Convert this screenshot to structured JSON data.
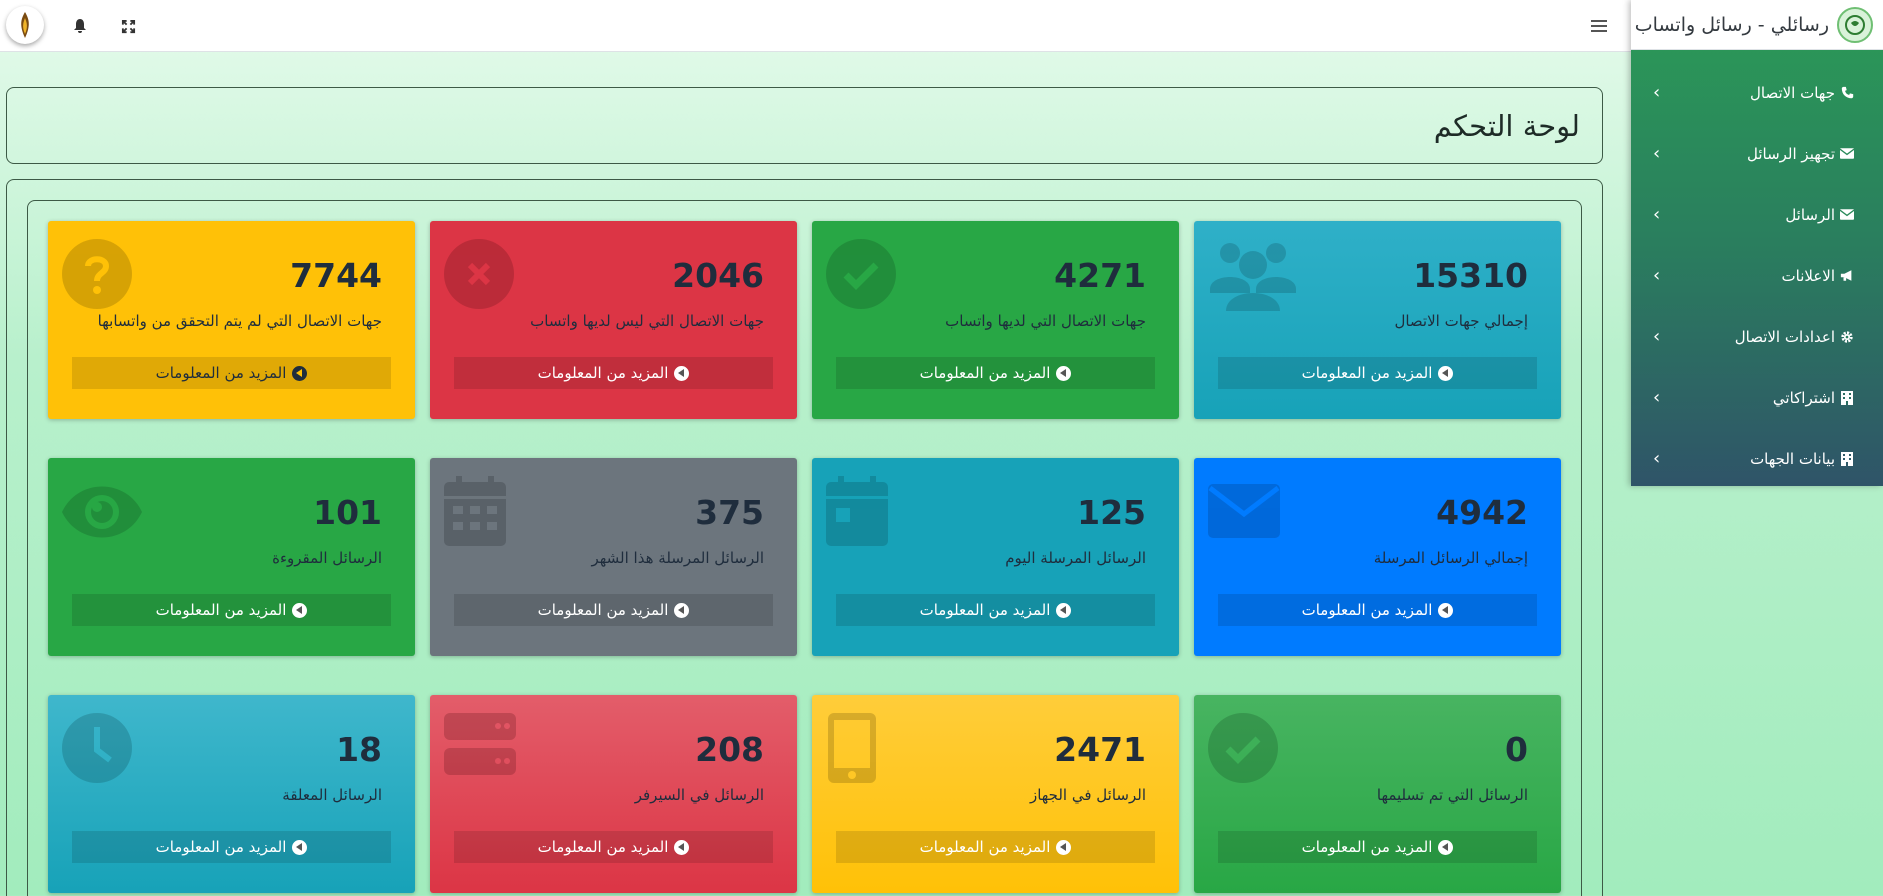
{
  "brand": {
    "title": "رسائلي - رسائل واتساب"
  },
  "page": {
    "title": "لوحة التحكم"
  },
  "sidebar": {
    "items": [
      {
        "label": "جهات الاتصال",
        "icon": "phone-icon"
      },
      {
        "label": "تجهيز الرسائل",
        "icon": "envelope-icon"
      },
      {
        "label": "الرسائل",
        "icon": "envelope-icon"
      },
      {
        "label": "الاعلانات",
        "icon": "bullhorn-icon"
      },
      {
        "label": "اعدادات الاتصال",
        "icon": "gear-icon"
      },
      {
        "label": "اشتراكاتي",
        "icon": "building-icon"
      },
      {
        "label": "بيانات الجهات",
        "icon": "building-icon"
      }
    ]
  },
  "cards": [
    {
      "value": "15310",
      "label": "إجمالي جهات الاتصال",
      "more": "المزيد من المعلومات",
      "color": "#17a2b8",
      "icon": "users-icon"
    },
    {
      "value": "4271",
      "label": "جهات الاتصال التي لديها واتساب",
      "more": "المزيد من المعلومات",
      "color": "#28a745",
      "icon": "check-circle-icon"
    },
    {
      "value": "2046",
      "label": "جهات الاتصال التي ليس لديها واتساب",
      "more": "المزيد من المعلومات",
      "color": "#dc3545",
      "icon": "times-circle-icon"
    },
    {
      "value": "7744",
      "label": "جهات الاتصال التي لم يتم التحقق من واتسابها",
      "more": "المزيد من المعلومات",
      "color": "#ffc107",
      "icon": "question-circle-icon"
    },
    {
      "value": "4942",
      "label": "إجمالي الرسائل المرسلة",
      "more": "المزيد من المعلومات",
      "color": "#007bff",
      "icon": "envelope-icon"
    },
    {
      "value": "125",
      "label": "الرسائل المرسلة اليوم",
      "more": "المزيد من المعلومات",
      "color": "#17a2b8",
      "icon": "calendar-day-icon"
    },
    {
      "value": "375",
      "label": "الرسائل المرسلة هذا الشهر",
      "more": "المزيد من المعلومات",
      "color": "#6c757d",
      "icon": "calendar-icon"
    },
    {
      "value": "101",
      "label": "الرسائل المقروءة",
      "more": "المزيد من المعلومات",
      "color": "#28a745",
      "icon": "eye-icon"
    },
    {
      "value": "0",
      "label": "الرسائل التي تم تسليمها",
      "more": "المزيد من المعلومات",
      "color": "#28a745",
      "icon": "check-circle-icon"
    },
    {
      "value": "2471",
      "label": "الرسائل في الجهاز",
      "more": "المزيد من المعلومات",
      "color": "#ffc107",
      "icon": "mobile-icon"
    },
    {
      "value": "208",
      "label": "الرسائل في السيرفر",
      "more": "المزيد من المعلومات",
      "color": "#dc3545",
      "icon": "server-icon"
    },
    {
      "value": "18",
      "label": "الرسائل المعلقة",
      "more": "المزيد من المعلومات",
      "color": "#17a2b8",
      "icon": "clock-icon"
    }
  ]
}
